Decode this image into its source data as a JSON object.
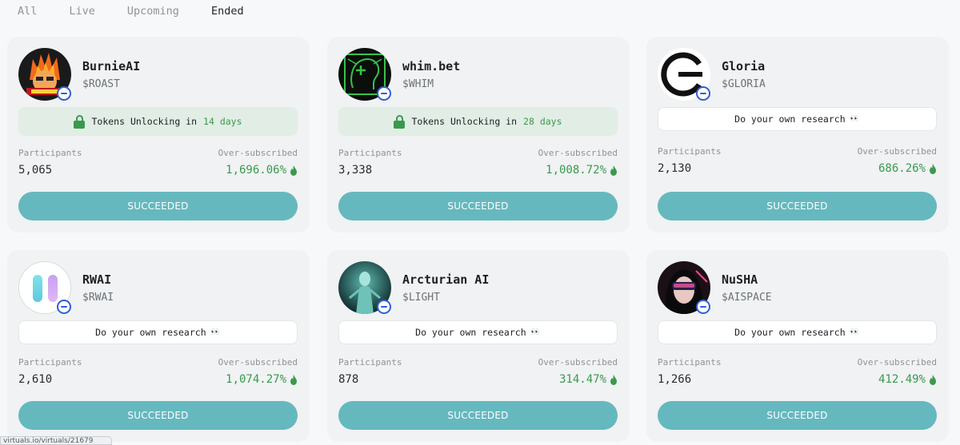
{
  "tabs": [
    {
      "label": "All",
      "active": false
    },
    {
      "label": "Live",
      "active": false
    },
    {
      "label": "Upcoming",
      "active": false
    },
    {
      "label": "Ended",
      "active": true
    }
  ],
  "labels": {
    "participants": "Participants",
    "over_subscribed": "Over-subscribed",
    "unlock_prefix": "Tokens Unlocking in",
    "dyor": "Do your own research",
    "dyor_emoji": "👀"
  },
  "cards": [
    {
      "name": "BurnieAI",
      "ticker": "$ROAST",
      "participants": "5,065",
      "over_subscribed": "1,696.06%",
      "unlock_days": "14 days",
      "status": "SUCCEEDED",
      "avatar_icon": "burnie-avatar"
    },
    {
      "name": "whim.bet",
      "ticker": "$WHIM",
      "participants": "3,338",
      "over_subscribed": "1,008.72%",
      "unlock_days": "28 days",
      "status": "SUCCEEDED",
      "avatar_icon": "whim-avatar"
    },
    {
      "name": "Gloria",
      "ticker": "$GLORIA",
      "participants": "2,130",
      "over_subscribed": "686.26%",
      "status": "SUCCEEDED",
      "avatar_icon": "gloria-avatar"
    },
    {
      "name": "RWAI",
      "ticker": "$RWAI",
      "participants": "2,610",
      "over_subscribed": "1,074.27%",
      "status": "SUCCEEDED",
      "avatar_icon": "rwai-avatar"
    },
    {
      "name": "Arcturian AI",
      "ticker": "$LIGHT",
      "participants": "878",
      "over_subscribed": "314.47%",
      "status": "SUCCEEDED",
      "avatar_icon": "arcturian-avatar"
    },
    {
      "name": "NuSHA",
      "ticker": "$AISPACE",
      "participants": "1,266",
      "over_subscribed": "412.49%",
      "status": "SUCCEEDED",
      "avatar_icon": "nusha-avatar"
    }
  ],
  "status_bar": {
    "url": "virtuals.io/virtuals/21679"
  },
  "colors": {
    "accent_button": "#66b8bf",
    "success_green": "#3a9a4e",
    "chain_badge": "#2f5fd8"
  }
}
